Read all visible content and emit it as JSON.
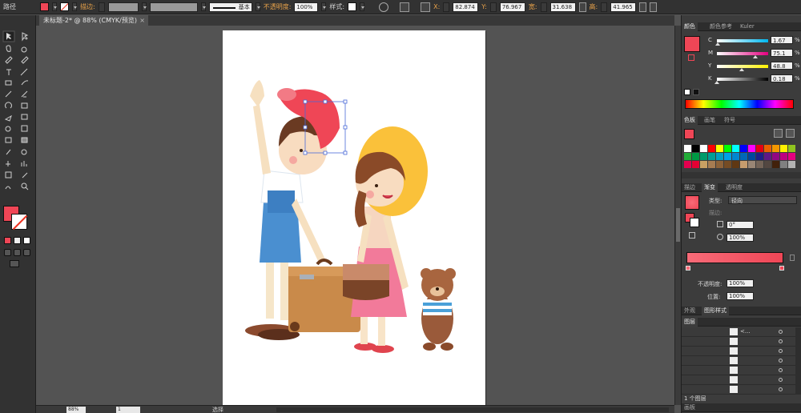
{
  "control_bar": {
    "selection_type": "路径",
    "stroke_label": "描边:",
    "stroke_style": "基本",
    "opacity_label": "不透明度:",
    "opacity_value": "100%",
    "style_label": "样式:",
    "x_label": "X:",
    "x_value": "82.874",
    "y_label": "Y:",
    "y_value": "76.967",
    "w_label": "宽:",
    "w_value": "31.638",
    "h_label": "高:",
    "h_value": "41.965"
  },
  "document": {
    "tab_title": "未标题-2* @ 88% (CMYK/预览)",
    "close_glyph": "×"
  },
  "colors": {
    "fill": "#ef4656",
    "stroke": "#ffffff",
    "ui_dark": "#323232",
    "canvas_bg": "#535353"
  },
  "color_panel": {
    "tabs": [
      "颜色",
      "颜色参考",
      "Kuler"
    ],
    "channels": [
      {
        "label": "C",
        "value": "1.67",
        "unit": "%",
        "fraction": 0.017,
        "gradient": "linear-gradient(90deg,#ffffff,#00b7ef)"
      },
      {
        "label": "M",
        "value": "75.1",
        "unit": "%",
        "fraction": 0.751,
        "gradient": "linear-gradient(90deg,#ffffff,#e4007f)"
      },
      {
        "label": "Y",
        "value": "48.8",
        "unit": "%",
        "fraction": 0.488,
        "gradient": "linear-gradient(90deg,#ffffff,#fff100)"
      },
      {
        "label": "K",
        "value": "0.18",
        "unit": "%",
        "fraction": 0.002,
        "gradient": "linear-gradient(90deg,#ffffff,#000000)"
      }
    ]
  },
  "swatches_panel": {
    "tabs": [
      "色板",
      "画笔",
      "符号"
    ]
  },
  "gradient_panel": {
    "tabs": [
      "描边",
      "渐变",
      "透明度"
    ],
    "type_label": "类型:",
    "type_value": "径向",
    "stroke_label": "描边:",
    "angle_value": "0°",
    "aspect_value": "100%",
    "opacity_label": "不透明度:",
    "opacity_value": "100%",
    "location_label": "位置:",
    "location_value": "100%",
    "gradient_from": "#f86b78",
    "gradient_to": "#ef4656"
  },
  "appearance_panel": {
    "tabs": [
      "外观",
      "图形样式"
    ]
  },
  "layers_panel": {
    "tab": "图层",
    "footer": "1 个图层",
    "first_layer_label": "<..."
  },
  "status_bar": {
    "zoom": "88%",
    "page": "1",
    "tool_text": "选择"
  },
  "artboards_tab": "画板"
}
